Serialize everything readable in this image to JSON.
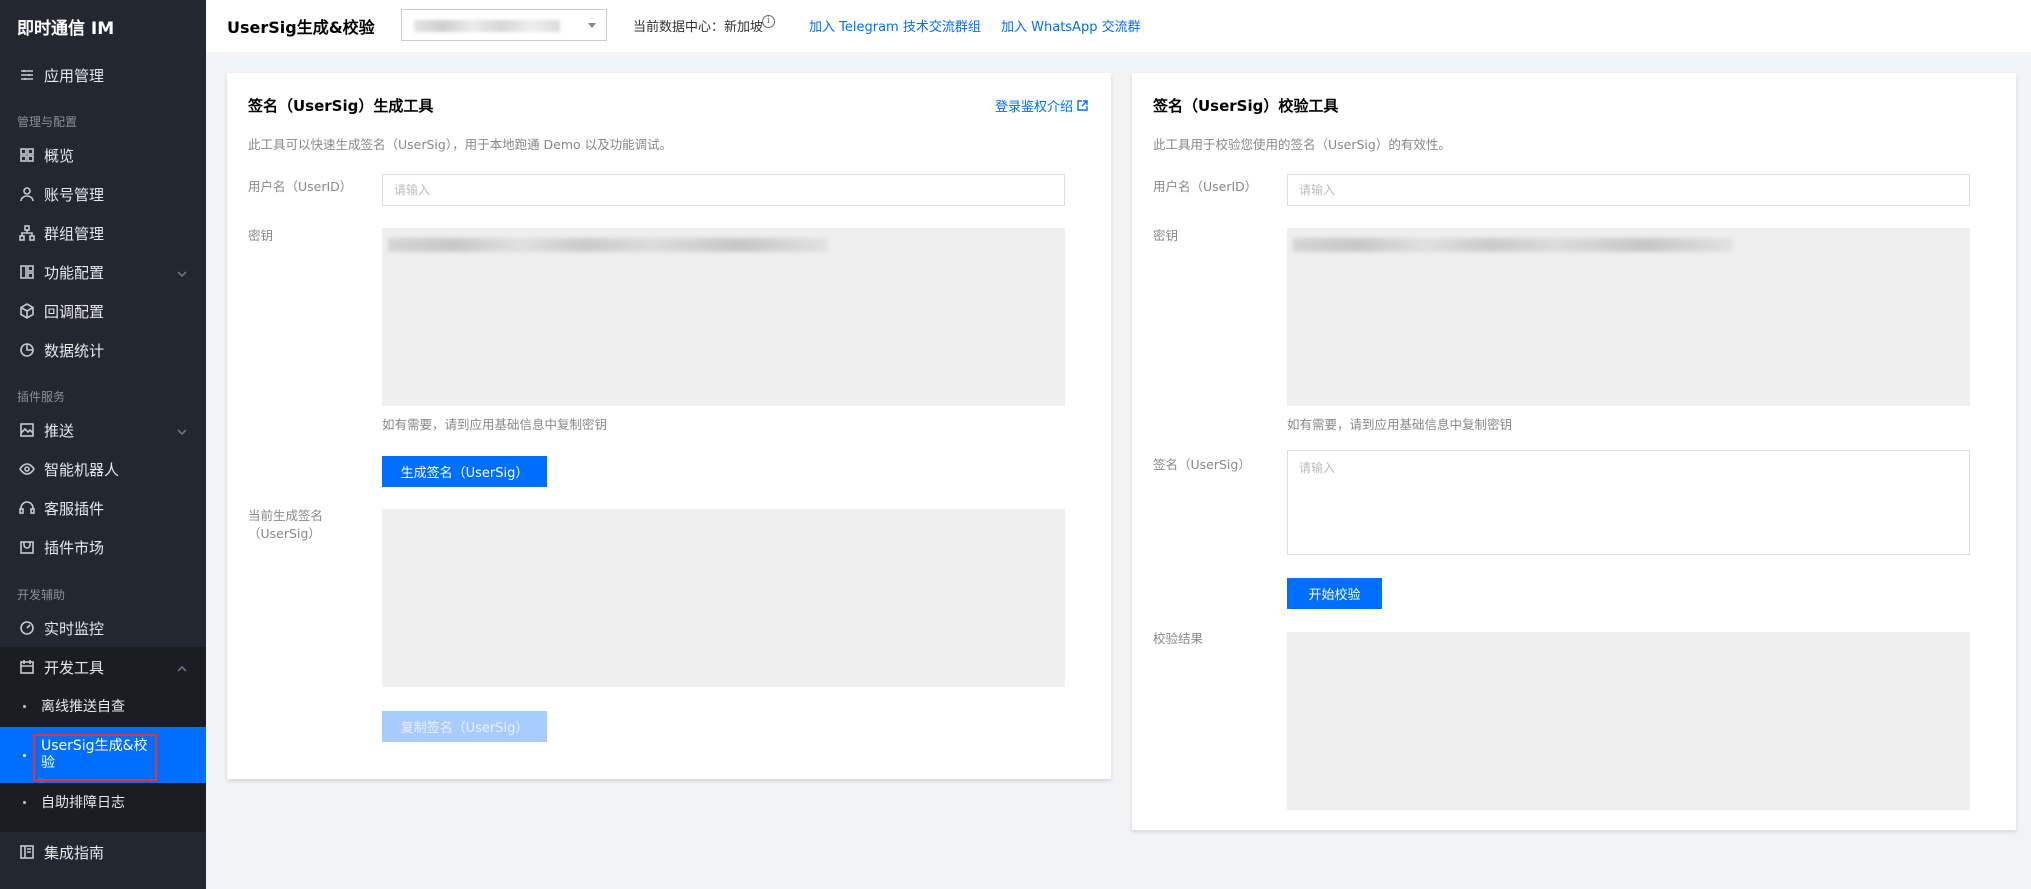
{
  "sidebar": {
    "brand": "即时通信 IM",
    "app_management": "应用管理",
    "group_manage_config": "管理与配置",
    "overview": "概览",
    "account_management": "账号管理",
    "group_management": "群组管理",
    "feature_config": "功能配置",
    "callback_config": "回调配置",
    "data_stats": "数据统计",
    "group_plugins": "插件服务",
    "push": "推送",
    "chatbot": "智能机器人",
    "customer_service": "客服插件",
    "plugin_market": "插件市场",
    "group_dev_aids": "开发辅助",
    "realtime_monitor": "实时监控",
    "dev_tools": "开发工具",
    "sub_offline_push": "离线推送自查",
    "sub_usersig": "UserSig生成&校验",
    "sub_usersig_line1": "UserSig生成&校",
    "sub_usersig_line2": "验",
    "sub_troubleshoot": "自助排障日志",
    "integration_guide": "集成指南"
  },
  "header": {
    "title": "UserSig生成&校验",
    "datacenter_label": "当前数据中心：新加坡",
    "telegram_link": "加入 Telegram 技术交流群组",
    "whatsapp_link": "加入 WhatsApp 交流群"
  },
  "generator": {
    "title": "签名（UserSig）生成工具",
    "intro_link": "登录鉴权介绍",
    "description": "此工具可以快速生成签名（UserSig），用于本地跑通 Demo 以及功能调试。",
    "userid_label": "用户名（UserID）",
    "userid_placeholder": "请输入",
    "key_label": "密钥",
    "key_hint": "如有需要，请到应用基础信息中复制密钥",
    "generate_button": "生成签名（UserSig）",
    "current_sig_label_line1": "当前生成签名",
    "current_sig_label_line2": "（UserSig）",
    "copy_button": "复制签名（UserSig）"
  },
  "verifier": {
    "title": "签名（UserSig）校验工具",
    "description": "此工具用于校验您使用的签名（UserSig）的有效性。",
    "userid_label": "用户名（UserID）",
    "userid_placeholder": "请输入",
    "key_label": "密钥",
    "key_hint": "如有需要，请到应用基础信息中复制密钥",
    "sig_label": "签名（UserSig）",
    "sig_placeholder": "请输入",
    "verify_button": "开始校验",
    "result_label": "校验结果"
  },
  "colors": {
    "accent": "#006eff",
    "sidebar_bg": "#232730",
    "active_bg": "#006eff",
    "highlight": "#e5343b"
  }
}
